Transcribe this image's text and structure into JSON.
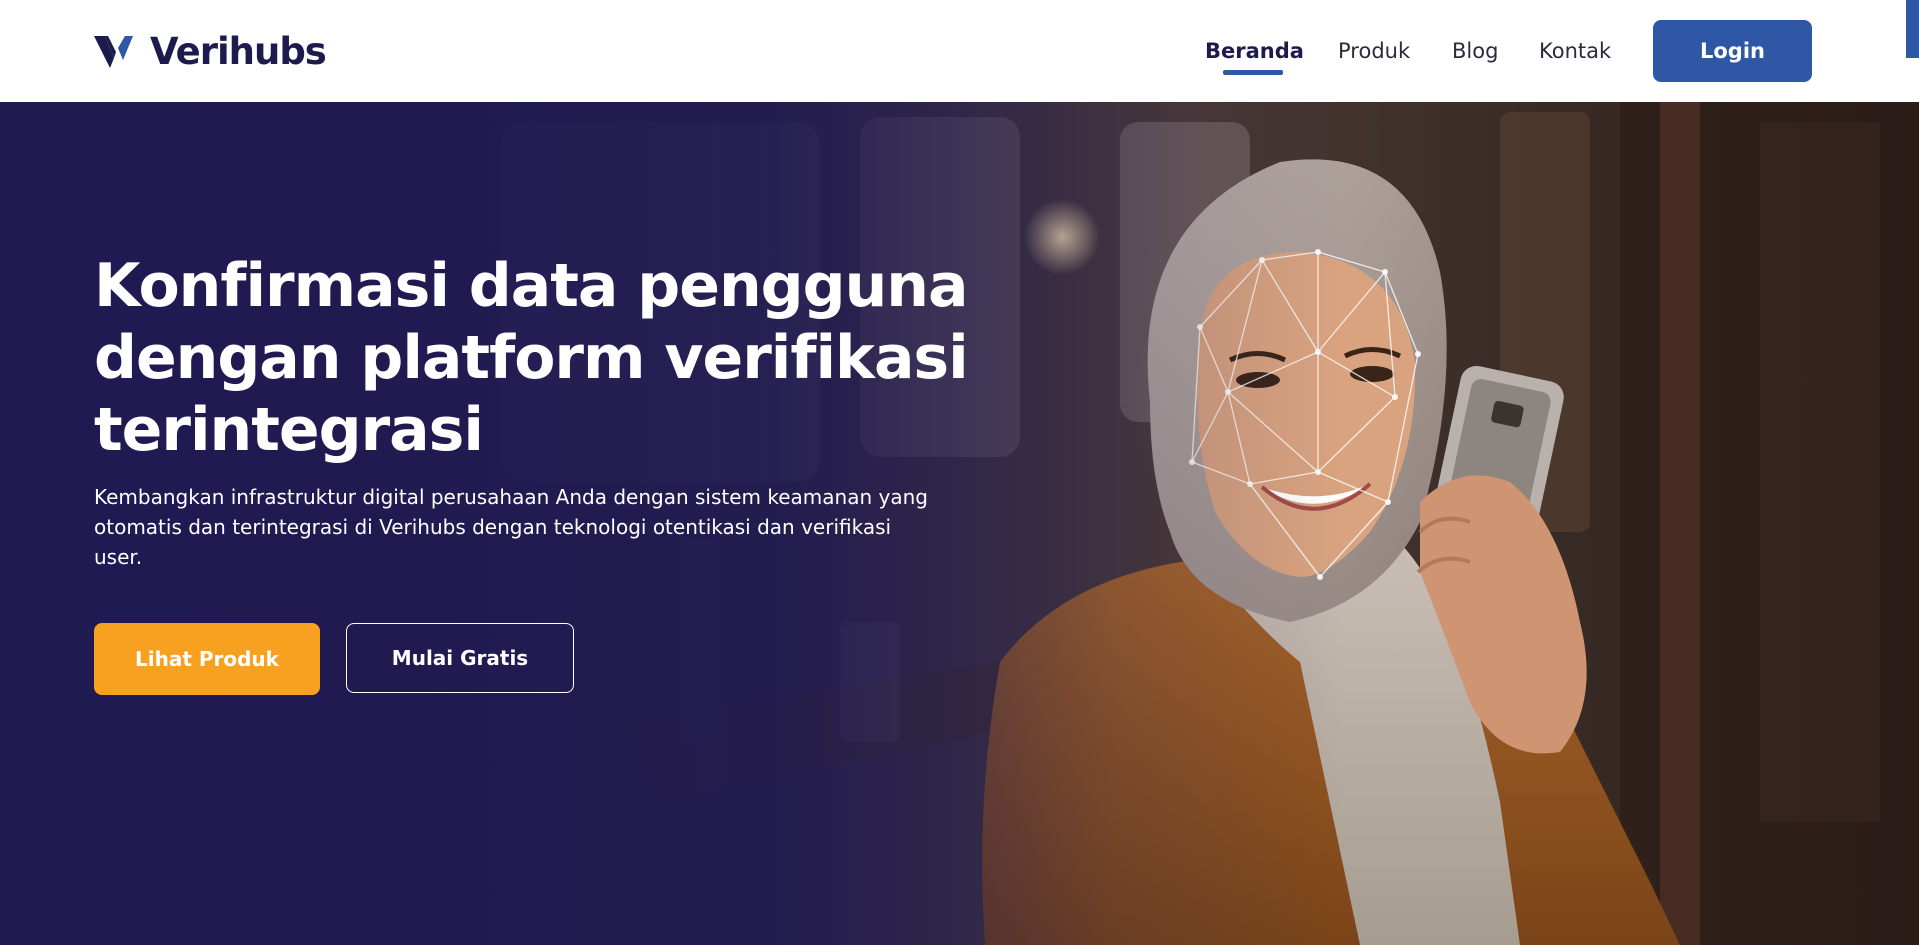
{
  "brand": {
    "name": "Verihubs",
    "accent": "#2e57a6",
    "dark": "#1d1b4e",
    "orange": "#f8a121"
  },
  "nav": {
    "items": [
      {
        "label": "Beranda",
        "active": true
      },
      {
        "label": "Produk",
        "active": false
      },
      {
        "label": "Blog",
        "active": false
      },
      {
        "label": "Kontak",
        "active": false
      }
    ],
    "login_label": "Login"
  },
  "hero": {
    "title": "Konfirmasi data pengguna dengan platform verifikasi terintegrasi",
    "subtitle": "Kembangkan infrastruktur digital perusahaan Anda dengan sistem keamanan yang otomatis dan terintegrasi di Verihubs dengan teknologi otentikasi dan verifikasi user.",
    "primary_button": "Lihat Produk",
    "secondary_button": "Mulai Gratis",
    "image": "woman-using-face-verification-on-phone"
  }
}
